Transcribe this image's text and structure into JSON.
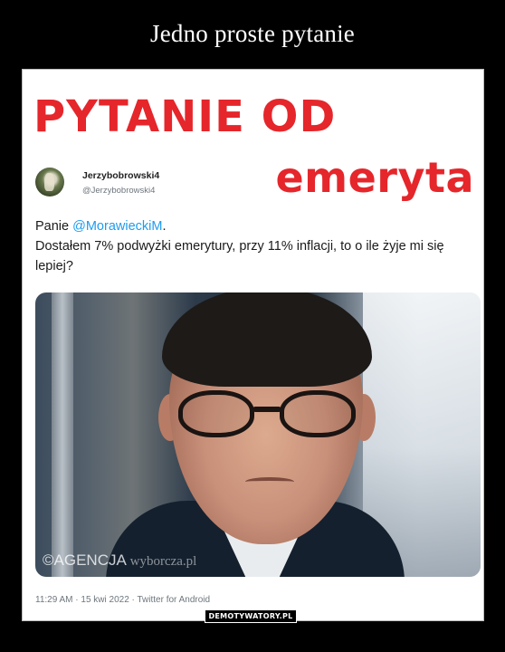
{
  "poster": {
    "title": "Jedno proste pytanie",
    "site_badge": "DEMOTYWATORY.PL"
  },
  "headline": {
    "line1": "PYTANIE OD",
    "line2": "emeryta",
    "color": "#e5262b"
  },
  "tweet": {
    "user_name": "Jerzybobrowski4",
    "user_handle": "@Jerzybobrowski4",
    "text_prefix": "Panie ",
    "mention": "@MorawieckiM",
    "text_after_mention": ".",
    "text_body": "Dostałem 7% podwyżki emerytury, przy 11% inflacji, to o ile żyje mi się lepiej?",
    "meta": "11:29 AM · 15 kwi 2022 · Twitter for Android",
    "mention_color": "#1d9bf0"
  },
  "photo": {
    "watermark_main": "©AGENCJA",
    "watermark_light": "wyborcza.pl",
    "icon": "portrait-photo"
  }
}
